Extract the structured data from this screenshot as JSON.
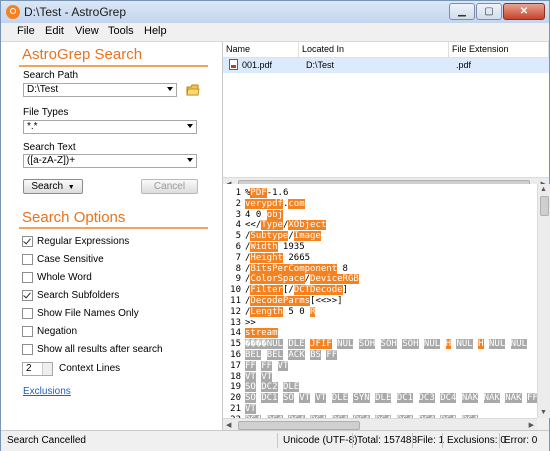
{
  "window": {
    "title": "D:\\Test - AstroGrep"
  },
  "menu": [
    "File",
    "Edit",
    "View",
    "Tools",
    "Help"
  ],
  "search_panel": {
    "heading": "AstroGrep Search",
    "path_label": "Search Path",
    "path_value": "D:\\Test",
    "types_label": "File Types",
    "types_value": "*.*",
    "text_label": "Search Text",
    "text_value": "([a-zA-Z])+",
    "search_button": "Search",
    "cancel_button": "Cancel"
  },
  "options": {
    "heading": "Search Options",
    "items": [
      {
        "label": "Regular Expressions",
        "checked": true
      },
      {
        "label": "Case Sensitive",
        "checked": false
      },
      {
        "label": "Whole Word",
        "checked": false
      },
      {
        "label": "Search Subfolders",
        "checked": true
      },
      {
        "label": "Show File Names Only",
        "checked": false
      },
      {
        "label": "Negation",
        "checked": false
      },
      {
        "label": "Show all results after search",
        "checked": false
      }
    ],
    "context_value": "2",
    "context_label": "Context Lines",
    "exclusions_link": "Exclusions"
  },
  "results": {
    "columns": [
      "Name",
      "Located In",
      "File Extension"
    ],
    "rows": [
      {
        "name": "001.pdf",
        "location": "D:\\Test",
        "ext": ".pdf"
      }
    ]
  },
  "preview": {
    "lines": [
      {
        "n": "1",
        "parts": [
          {
            "t": "%"
          },
          {
            "t": "PDF",
            "h": true
          },
          {
            "t": "-1.6"
          }
        ]
      },
      {
        "n": "2",
        "parts": [
          {
            "t": "verypdf",
            "h": true
          },
          {
            "t": "."
          },
          {
            "t": "com",
            "h": true
          }
        ]
      },
      {
        "n": "3",
        "parts": [
          {
            "t": "4 0 "
          },
          {
            "t": "obj",
            "h": true
          }
        ]
      },
      {
        "n": "4",
        "parts": [
          {
            "t": "<</"
          },
          {
            "t": "Type",
            "h": true
          },
          {
            "t": "/"
          },
          {
            "t": "XObject",
            "h": true
          }
        ]
      },
      {
        "n": "5",
        "parts": [
          {
            "t": "/"
          },
          {
            "t": "Subtype",
            "h": true
          },
          {
            "t": "/"
          },
          {
            "t": "Image",
            "h": true
          }
        ]
      },
      {
        "n": "6",
        "parts": [
          {
            "t": "/"
          },
          {
            "t": "Width",
            "h": true
          },
          {
            "t": " 1935"
          }
        ]
      },
      {
        "n": "7",
        "parts": [
          {
            "t": "/"
          },
          {
            "t": "Height",
            "h": true
          },
          {
            "t": " 2665"
          }
        ]
      },
      {
        "n": "8",
        "parts": [
          {
            "t": "/"
          },
          {
            "t": "BitsPerComponent",
            "h": true
          },
          {
            "t": " 8"
          }
        ]
      },
      {
        "n": "9",
        "parts": [
          {
            "t": "/"
          },
          {
            "t": "ColorSpace",
            "h": true
          },
          {
            "t": "/"
          },
          {
            "t": "DeviceRGB",
            "h": true
          }
        ]
      },
      {
        "n": "10",
        "parts": [
          {
            "t": "/"
          },
          {
            "t": "Filter",
            "h": true
          },
          {
            "t": "["
          },
          {
            "t": "/"
          },
          {
            "t": "DCTDecode",
            "h": true
          },
          {
            "t": "]"
          }
        ]
      },
      {
        "n": "11",
        "parts": [
          {
            "t": "/"
          },
          {
            "t": "DecodeParms",
            "h": true
          },
          {
            "t": "[<<>>]"
          }
        ]
      },
      {
        "n": "12",
        "parts": [
          {
            "t": "/"
          },
          {
            "t": "Length",
            "h": true
          },
          {
            "t": " 5 0 "
          },
          {
            "t": "R",
            "h": true
          }
        ]
      },
      {
        "n": "13",
        "parts": [
          {
            "t": ">>"
          }
        ]
      },
      {
        "n": "14",
        "parts": [
          {
            "t": "stream",
            "h": true
          }
        ]
      },
      {
        "n": "15",
        "parts": [
          {
            "t": "����",
            "g": true
          },
          {
            "t": "NUL",
            "g": true
          },
          {
            "t": " "
          },
          {
            "t": "DLE",
            "g": true
          },
          {
            "t": " "
          },
          {
            "t": "JFIF",
            "h": true
          },
          {
            "t": " "
          },
          {
            "t": "NUL",
            "g": true
          },
          {
            "t": " "
          },
          {
            "t": "SOH",
            "g": true
          },
          {
            "t": " "
          },
          {
            "t": "SOH",
            "g": true
          },
          {
            "t": " "
          },
          {
            "t": "SOH",
            "g": true
          },
          {
            "t": " "
          },
          {
            "t": "NUL",
            "g": true
          },
          {
            "t": " "
          },
          {
            "t": "H",
            "h": true
          },
          {
            "t": " "
          },
          {
            "t": "NUL",
            "g": true
          },
          {
            "t": " "
          },
          {
            "t": "H",
            "h": true
          },
          {
            "t": " "
          },
          {
            "t": "NUL",
            "g": true
          },
          {
            "t": " "
          },
          {
            "t": "NUL",
            "g": true
          }
        ]
      },
      {
        "n": "16",
        "parts": [
          {
            "t": "BEL",
            "g": true
          },
          {
            "t": " "
          },
          {
            "t": "BEL",
            "g": true
          },
          {
            "t": " "
          },
          {
            "t": "ACK",
            "g": true
          },
          {
            "t": " "
          },
          {
            "t": "BS",
            "g": true
          },
          {
            "t": " "
          },
          {
            "t": "FF",
            "g": true
          }
        ]
      },
      {
        "n": "17",
        "parts": [
          {
            "t": "FF",
            "g": true
          },
          {
            "t": " "
          },
          {
            "t": "FF",
            "g": true
          },
          {
            "t": " "
          },
          {
            "t": "VT",
            "g": true
          }
        ]
      },
      {
        "n": "18",
        "parts": [
          {
            "t": "VT",
            "g": true
          },
          {
            "t": " "
          },
          {
            "t": "VT",
            "g": true
          }
        ]
      },
      {
        "n": "19",
        "parts": [
          {
            "t": "SO",
            "g": true
          },
          {
            "t": " "
          },
          {
            "t": "DC2",
            "g": true
          },
          {
            "t": " "
          },
          {
            "t": "DLE",
            "g": true
          }
        ]
      },
      {
        "n": "20",
        "parts": [
          {
            "t": "SO",
            "g": true
          },
          {
            "t": " "
          },
          {
            "t": "DC1",
            "g": true
          },
          {
            "t": " "
          },
          {
            "t": "SO",
            "g": true
          },
          {
            "t": " "
          },
          {
            "t": "VT",
            "g": true
          },
          {
            "t": " "
          },
          {
            "t": "VT",
            "g": true
          },
          {
            "t": " "
          },
          {
            "t": "DLE",
            "g": true
          },
          {
            "t": " "
          },
          {
            "t": "SYN",
            "g": true
          },
          {
            "t": " "
          },
          {
            "t": "DLE",
            "g": true
          },
          {
            "t": " "
          },
          {
            "t": "DC1",
            "g": true
          },
          {
            "t": " "
          },
          {
            "t": "DC3",
            "g": true
          },
          {
            "t": " "
          },
          {
            "t": "DC4",
            "g": true
          },
          {
            "t": " "
          },
          {
            "t": "NAK",
            "g": true
          },
          {
            "t": " "
          },
          {
            "t": "NAK",
            "g": true
          },
          {
            "t": " "
          },
          {
            "t": "NAK",
            "g": true
          },
          {
            "t": " "
          },
          {
            "t": "FF",
            "g": true
          },
          {
            "t": " "
          },
          {
            "t": "SI",
            "g": true
          }
        ]
      },
      {
        "n": "21",
        "parts": [
          {
            "t": "VT",
            "g": true
          }
        ]
      },
      {
        "n": "22",
        "parts": [
          {
            "t": "DC4",
            "g": true
          },
          {
            "t": " "
          },
          {
            "t": "DC4",
            "g": true
          },
          {
            "t": " "
          },
          {
            "t": "DC4",
            "g": true
          },
          {
            "t": " "
          },
          {
            "t": "DC4",
            "g": true
          },
          {
            "t": " "
          },
          {
            "t": "DC4",
            "g": true
          },
          {
            "t": " "
          },
          {
            "t": "DC4",
            "g": true
          },
          {
            "t": " "
          },
          {
            "t": "DC4",
            "g": true
          },
          {
            "t": " "
          },
          {
            "t": "DC4",
            "g": true
          },
          {
            "t": " "
          },
          {
            "t": "DC4",
            "g": true
          },
          {
            "t": " "
          },
          {
            "t": "DC4",
            "g": true
          },
          {
            "t": " "
          },
          {
            "t": "DC4",
            "g": true
          }
        ]
      },
      {
        "n": "23",
        "parts": [
          {
            "t": "!",
            "h": true
          },
          {
            "t": "BEL",
            "g": true
          },
          {
            "t": "�"
          },
          {
            "t": "ETX",
            "g": true
          },
          {
            "t": "SOH",
            "g": true
          },
          {
            "t": "\""
          },
          {
            "t": " "
          },
          {
            "t": "NUL",
            "g": true
          },
          {
            "t": " "
          },
          {
            "t": "STX",
            "g": true
          },
          {
            "t": " "
          },
          {
            "t": "DC1",
            "g": true
          },
          {
            "t": " "
          },
          {
            "t": "SOH",
            "g": true
          },
          {
            "t": " "
          },
          {
            "t": "ETX",
            "g": true
          },
          {
            "t": " "
          },
          {
            "t": "DC1",
            "g": true
          },
          {
            "t": " "
          },
          {
            "t": "SOH",
            "g": true
          },
          {
            "t": "��",
            "g": true
          },
          {
            "t": " "
          },
          {
            "t": "NUL",
            "g": true
          },
          {
            "t": " "
          },
          {
            "t": "US",
            "g": true
          },
          {
            "t": " "
          },
          {
            "t": "NUL",
            "g": true
          }
        ]
      }
    ]
  },
  "status": {
    "message": "Search Cancelled",
    "encoding": "Unicode (UTF-8)",
    "total": "Total: 157488",
    "file": "File: 1",
    "exclusions": "Exclusions: 0",
    "error": "Error: 0"
  },
  "colors": {
    "accent": "#f58220",
    "link": "#1e5fbf",
    "highlight": "#f58220",
    "control_char": "#a9a9a9"
  }
}
